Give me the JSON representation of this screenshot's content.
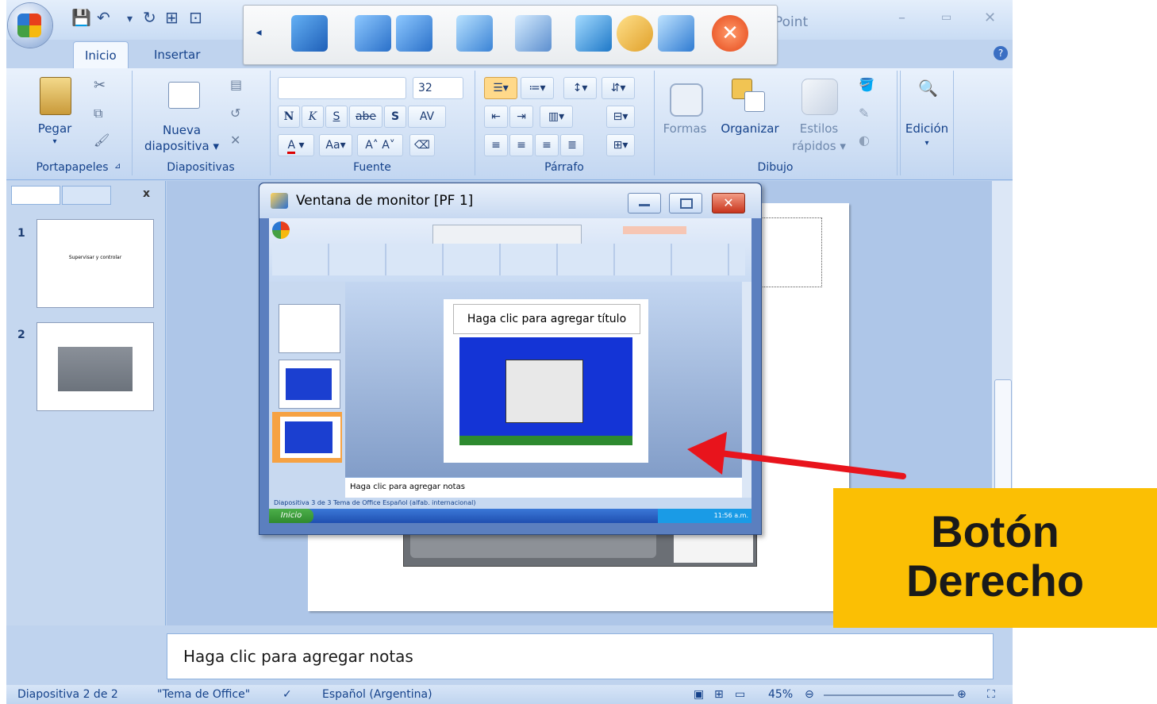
{
  "window": {
    "title_partial": "Point"
  },
  "tabs": {
    "inicio": "Inicio",
    "insertar": "Insertar"
  },
  "ribbon": {
    "portapapeles": {
      "label": "Portapapeles",
      "pegar": "Pegar"
    },
    "diapositivas": {
      "label": "Diapositivas",
      "nueva": "Nueva",
      "diapositiva": "diapositiva"
    },
    "fuente": {
      "label": "Fuente",
      "size": "32",
      "bold": "N",
      "italic": "K",
      "underline": "S",
      "strike": "abe",
      "shadow": "S",
      "spacing": "AV"
    },
    "parrafo": {
      "label": "Párrafo"
    },
    "dibujo": {
      "label": "Dibujo",
      "formas": "Formas",
      "organizar": "Organizar",
      "estilos": "Estilos",
      "rapidos": "rápidos"
    },
    "edicion": {
      "label": "Edición"
    }
  },
  "slide_pane": {
    "thumbs": [
      {
        "num": "1",
        "text": "Supervisar y controlar"
      },
      {
        "num": "2"
      }
    ]
  },
  "notes": {
    "placeholder": "Haga clic para agregar notas"
  },
  "status": {
    "slide": "Diapositiva 2 de 2",
    "theme": "\"Tema de Office\"",
    "language": "Español (Argentina)",
    "zoom": "45%"
  },
  "monitor": {
    "title": "Ventana de monitor [PF 1]",
    "inner_title_placeholder": "Haga clic para agregar título",
    "inner_notes": "Haga clic para agregar notas",
    "inner_status": "Diapositiva 3 de 3   Tema de Office   Español (alfab. internacional)",
    "inner_start": "Inicio",
    "inner_clock": "11:56 a.m."
  },
  "callout": {
    "line1": "Botón",
    "line2": "Derecho"
  },
  "colors": {
    "callout": "#fbbf04",
    "arrow": "#e8141c",
    "ribbon": "#cfdff4"
  }
}
